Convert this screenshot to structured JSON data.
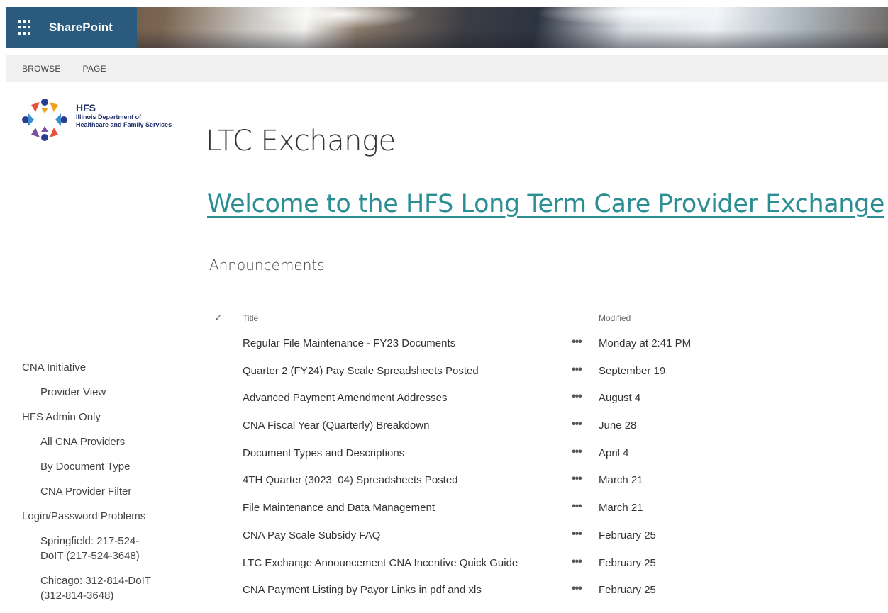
{
  "suitebar": {
    "brand": "SharePoint"
  },
  "ribbon": {
    "tabs": [
      "BROWSE",
      "PAGE"
    ]
  },
  "logo": {
    "short": "HFS",
    "line1": "Illinois Department of",
    "line2": "Healthcare and Family Services"
  },
  "page": {
    "site_title": "LTC Exchange",
    "welcome": "Welcome to the HFS Long Term Care Provider Exchange",
    "announcements_title": "Announcements"
  },
  "nav": [
    {
      "label": "CNA Initiative",
      "level": 0
    },
    {
      "label": "Provider View",
      "level": 1
    },
    {
      "label": "HFS Admin Only",
      "level": 0
    },
    {
      "label": "All CNA Providers",
      "level": 1
    },
    {
      "label": "By Document Type",
      "level": 1
    },
    {
      "label": "CNA Provider Filter",
      "level": 1
    },
    {
      "label": "Login/Password Problems",
      "level": 0
    },
    {
      "label": "Springfield: 217-524-DoIT (217-524-3648)",
      "level": 1
    },
    {
      "label": "Chicago: 312-814-DoIT (312-814-3648)",
      "level": 1
    }
  ],
  "list": {
    "check_icon": "checkmark-icon",
    "col_title": "Title",
    "col_modified": "Modified",
    "rows": [
      {
        "title": "Regular File Maintenance - FY23 Documents",
        "modified": "Monday at 2:41 PM"
      },
      {
        "title": "Quarter 2 (FY24) Pay Scale Spreadsheets Posted",
        "modified": "September 19"
      },
      {
        "title": "Advanced Payment Amendment Addresses",
        "modified": "August 4"
      },
      {
        "title": "CNA Fiscal Year (Quarterly) Breakdown",
        "modified": "June 28"
      },
      {
        "title": "Document Types and Descriptions",
        "modified": "April 4"
      },
      {
        "title": "4TH Quarter (3023_04) Spreadsheets Posted",
        "modified": "March 21"
      },
      {
        "title": "File Maintenance and Data Management",
        "modified": "March 21"
      },
      {
        "title": "CNA Pay Scale Subsidy FAQ",
        "modified": "February 25"
      },
      {
        "title": "LTC Exchange Announcement CNA Incentive Quick Guide",
        "modified": "February 25"
      },
      {
        "title": "CNA Payment Listing by Payor Links in pdf and xls",
        "modified": "February 25"
      }
    ]
  },
  "colors": {
    "suite_blue": "#2a5a7e",
    "link_teal": "#2b8e93",
    "ribbon_bg": "#f0f0f0"
  }
}
